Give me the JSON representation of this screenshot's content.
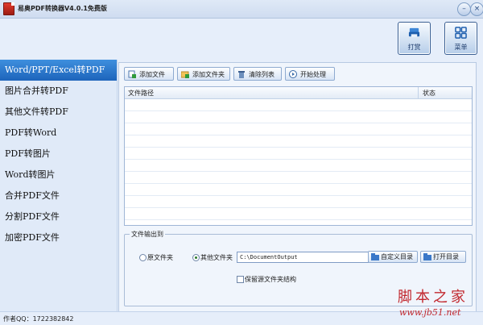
{
  "window": {
    "title": "易奥PDF转换器V4.0.1免费版",
    "minimize_icon": "minimize-icon",
    "close_icon": "close-icon"
  },
  "topbar": {
    "print_label": "打赏",
    "menu_label": "菜单"
  },
  "sidebar": {
    "items": [
      {
        "label": "Word/PPT/Excel转PDF",
        "active": true
      },
      {
        "label": "图片合并转PDF"
      },
      {
        "label": "其他文件转PDF"
      },
      {
        "label": "PDF转Word"
      },
      {
        "label": "PDF转图片"
      },
      {
        "label": "Word转图片"
      },
      {
        "label": "合并PDF文件"
      },
      {
        "label": "分割PDF文件"
      },
      {
        "label": "加密PDF文件"
      }
    ]
  },
  "toolbar": {
    "add_file": "添加文件",
    "add_folder": "添加文件夹",
    "clear_list": "清除列表",
    "start": "开始处理"
  },
  "table": {
    "columns": [
      "文件路径",
      "状态"
    ],
    "rows": []
  },
  "output": {
    "legend": "文件输出到",
    "option_source": "原文件夹",
    "option_other": "其他文件夹",
    "selected": "其他文件夹",
    "path": "C:\\DocumentOutput",
    "custom_dir": "自定义目录",
    "open_dir": "打开目录",
    "keep_structure": "保留源文件夹结构",
    "keep_structure_checked": false
  },
  "status": {
    "author": "作者QQ：1722382842"
  },
  "watermark": {
    "main": "脚本之家",
    "url": "www.jb51.net"
  },
  "colors": {
    "accent": "#1d64bb",
    "background": "#e6eefa"
  }
}
